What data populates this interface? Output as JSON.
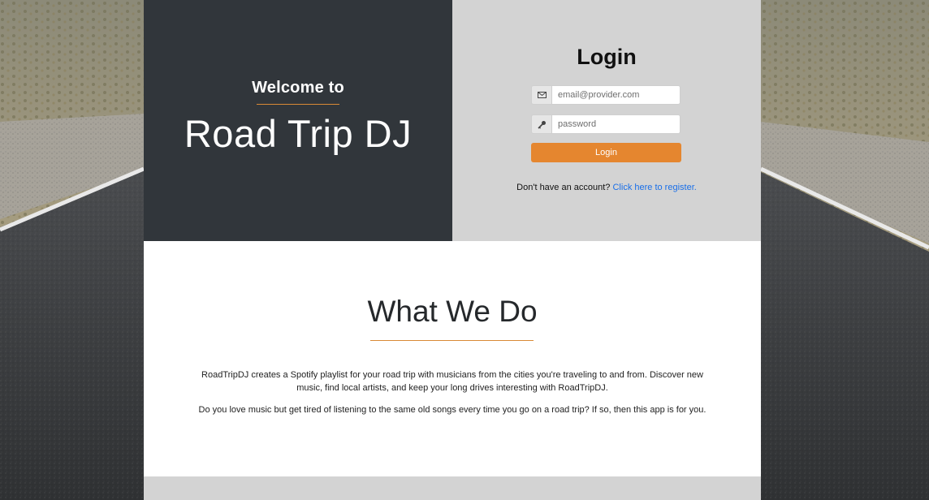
{
  "hero": {
    "welcome": "Welcome to",
    "brand": "Road Trip DJ"
  },
  "login": {
    "title": "Login",
    "email_placeholder": "email@provider.com",
    "password_placeholder": "password",
    "email_icon": "envelope-icon",
    "password_icon": "key-icon",
    "button_label": "Login",
    "register_prompt": "Don't have an account?",
    "register_link": "Click here to register."
  },
  "about": {
    "title": "What We Do",
    "paragraph1": "RoadTripDJ creates a Spotify playlist for your road trip with musicians from the cities you're traveling to and from. Discover new music, find local artists, and keep your long drives interesting with RoadTripDJ.",
    "paragraph2": "Do you love music but get tired of listening to the same old songs every time you go on a road trip? If so, then this app is for you."
  },
  "colors": {
    "accent": "#e5862f",
    "dark_panel": "#31363b",
    "light_panel": "#d3d3d3",
    "link": "#1a6fe8"
  }
}
